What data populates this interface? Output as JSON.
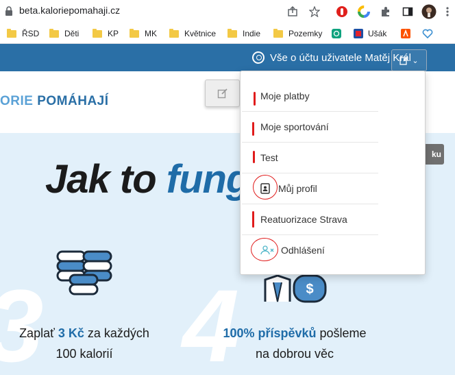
{
  "browser": {
    "url": "beta.kaloriepomahaji.cz",
    "bookmarks": [
      "ŘSD",
      "Děti",
      "KP",
      "MK",
      "Květnice",
      "Indie",
      "Pozemky",
      "Ušák"
    ]
  },
  "site": {
    "account_label": "Vše o účtu uživatele Matěj Král",
    "logo_part1": "ORIE",
    "logo_part2": "POMÁHAJÍ",
    "headline_part1": "Jak to ",
    "headline_part2": "fung",
    "lang_button": "ku",
    "step3_number": "3",
    "step4_number": "4",
    "step3_line1_pre": "Zaplať ",
    "step3_line1_hl": "3 Kč",
    "step3_line1_post": " za každých",
    "step3_line2": "100 kalorií",
    "step4_line1_hl": "100% příspěvků",
    "step4_line1_post": " pošleme",
    "step4_line2": "na dobrou věc",
    "dollar_sign": "$"
  },
  "menu": {
    "items": [
      {
        "label": "Moje platby"
      },
      {
        "label": "Moje sportování"
      },
      {
        "label": "Test"
      },
      {
        "label": "Můj profil",
        "icon": "profile-card-icon"
      },
      {
        "label": "Reatuorizace Strava"
      },
      {
        "label": "Odhlášení",
        "icon": "user-remove-icon"
      }
    ]
  },
  "colors": {
    "site_bar": "#2a6fa6",
    "hero_bg": "#e2f0fa",
    "accent": "#1f6ca8",
    "annotation": "#e01b1b"
  }
}
